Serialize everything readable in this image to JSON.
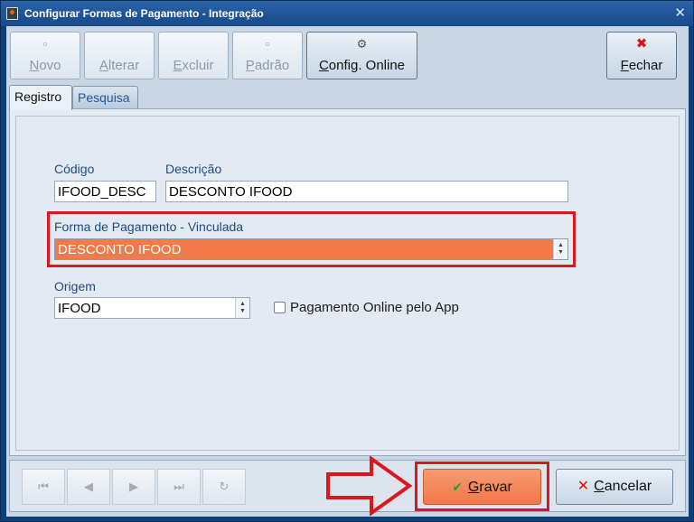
{
  "window": {
    "title": "Configurar Formas de Pagamento - Integração",
    "close_glyph": "✕"
  },
  "toolbar": {
    "novo": {
      "label_ul": "N",
      "label_rest": "ovo",
      "icon": "blank-page-icon",
      "enabled": false
    },
    "alterar": {
      "label_ul": "A",
      "label_rest": "lterar",
      "enabled": false
    },
    "excluir": {
      "label_ul": "E",
      "label_rest": "xcluir",
      "enabled": false
    },
    "padrao": {
      "label_ul": "P",
      "label_rest": "adrão",
      "icon": "blank-page-icon",
      "enabled": false
    },
    "config_online": {
      "label_ul": "C",
      "label_rest": "onfig. Online",
      "icon": "gear-icon",
      "enabled": true
    },
    "fechar": {
      "label_ul": "F",
      "label_rest": "echar",
      "icon": "close-icon",
      "enabled": true
    }
  },
  "tabs": {
    "registro": "Registro",
    "pesquisa": "Pesquisa"
  },
  "form": {
    "codigo_label": "Código",
    "codigo_value": "IFOOD_DESC",
    "descricao_label": "Descrição",
    "descricao_value": "DESCONTO IFOOD",
    "forma_label": "Forma de Pagamento - Vinculada",
    "forma_value": "DESCONTO IFOOD",
    "origem_label": "Origem",
    "origem_value": "IFOOD",
    "pagamento_online_label": "Pagamento Online pelo App",
    "pagamento_online_checked": false
  },
  "navigation": {
    "first": "⏮",
    "prev": "◀",
    "next": "▶",
    "last": "⏭",
    "refresh": "↻"
  },
  "actions": {
    "gravar_ul": "G",
    "gravar_rest": "ravar",
    "cancelar_ul": "C",
    "cancelar_rest": "ancelar"
  },
  "colors": {
    "highlight_border": "#e0151b",
    "selected_combo": "#f07a48",
    "gravar_button": "#f07748"
  }
}
